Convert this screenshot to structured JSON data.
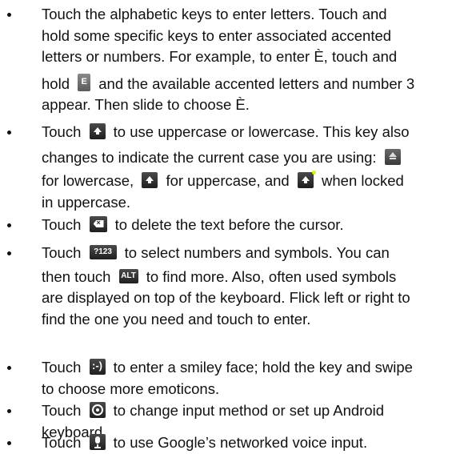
{
  "items": [
    {
      "lines": [
        "Touch the alphabetic keys to enter letters. Touch and",
        "hold some specific keys to enter associated accented",
        "letters or numbers. For example, to enter È, touch and"
      ],
      "hold": "hold",
      "e_key_label": "E",
      "rest1": "and the available accented letters and number 3",
      "last": "appear. Then slide to choose È."
    },
    {
      "touch": "Touch",
      "a": "to use uppercase or lowercase. This key also",
      "b": "changes to indicate the current case you are using:",
      "c": "for lowercase,",
      "d": "for uppercase, and",
      "e": "when locked",
      "f": "in uppercase."
    },
    {
      "touch": "Touch",
      "a": "to delete the text before the cursor."
    },
    {
      "touch": "Touch",
      "key123": "?123",
      "a": "to select numbers and symbols. You can",
      "b": "then touch",
      "alt": "ALT",
      "c": "to find more. Also, often used symbols",
      "d": "are displayed on top of the keyboard. Flick left or right to",
      "e": "find the one you need and touch to enter."
    },
    {
      "touch": "Touch",
      "smiley": ":-)",
      "a": "to enter a smiley face; hold the key and swipe",
      "b": "to choose more emoticons."
    },
    {
      "touch": "Touch",
      "a": "to change input method or set up Android",
      "b": "keyboard."
    },
    {
      "touch": "Touch",
      "a": "to use Google’s networked voice input."
    }
  ],
  "colors": {
    "text": "#111111",
    "key_dark": "#2f2f2f",
    "key_green": "#2f7a1f",
    "lock_dot": "#c6ff00"
  }
}
